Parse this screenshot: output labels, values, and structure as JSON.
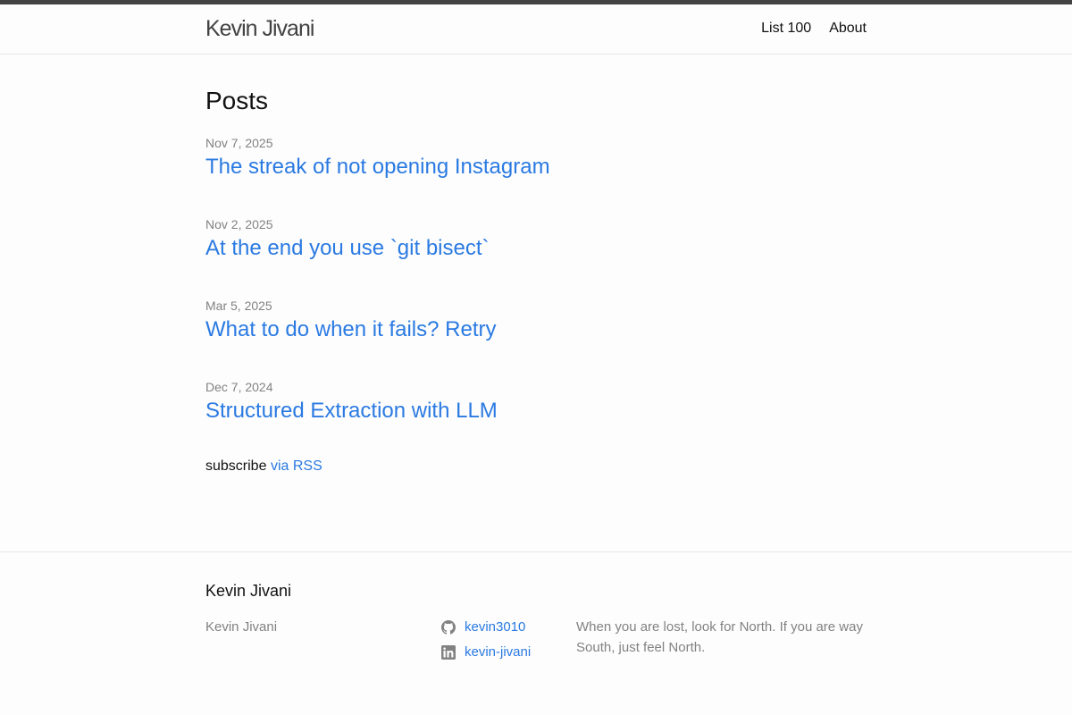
{
  "header": {
    "site_title": "Kevin Jivani",
    "nav": [
      {
        "label": "List 100"
      },
      {
        "label": "About"
      }
    ]
  },
  "main": {
    "heading": "Posts",
    "posts": [
      {
        "date": "Nov 7, 2025",
        "title": "The streak of not opening Instagram"
      },
      {
        "date": "Nov 2, 2025",
        "title": "At the end you use `git bisect`"
      },
      {
        "date": "Mar 5, 2025",
        "title": "What to do when it fails? Retry"
      },
      {
        "date": "Dec 7, 2024",
        "title": "Structured Extraction with LLM"
      }
    ],
    "rss_prefix": "subscribe",
    "rss_link": "via RSS"
  },
  "footer": {
    "heading": "Kevin Jivani",
    "name": "Kevin Jivani",
    "social": [
      {
        "icon": "github-icon",
        "label": "kevin3010"
      },
      {
        "icon": "linkedin-icon",
        "label": "kevin-jivani"
      }
    ],
    "description": "When you are lost, look for North. If you are way South, just feel North."
  },
  "colors": {
    "link": "#2a7ae2",
    "meta": "#828282",
    "topbar": "#424242"
  }
}
